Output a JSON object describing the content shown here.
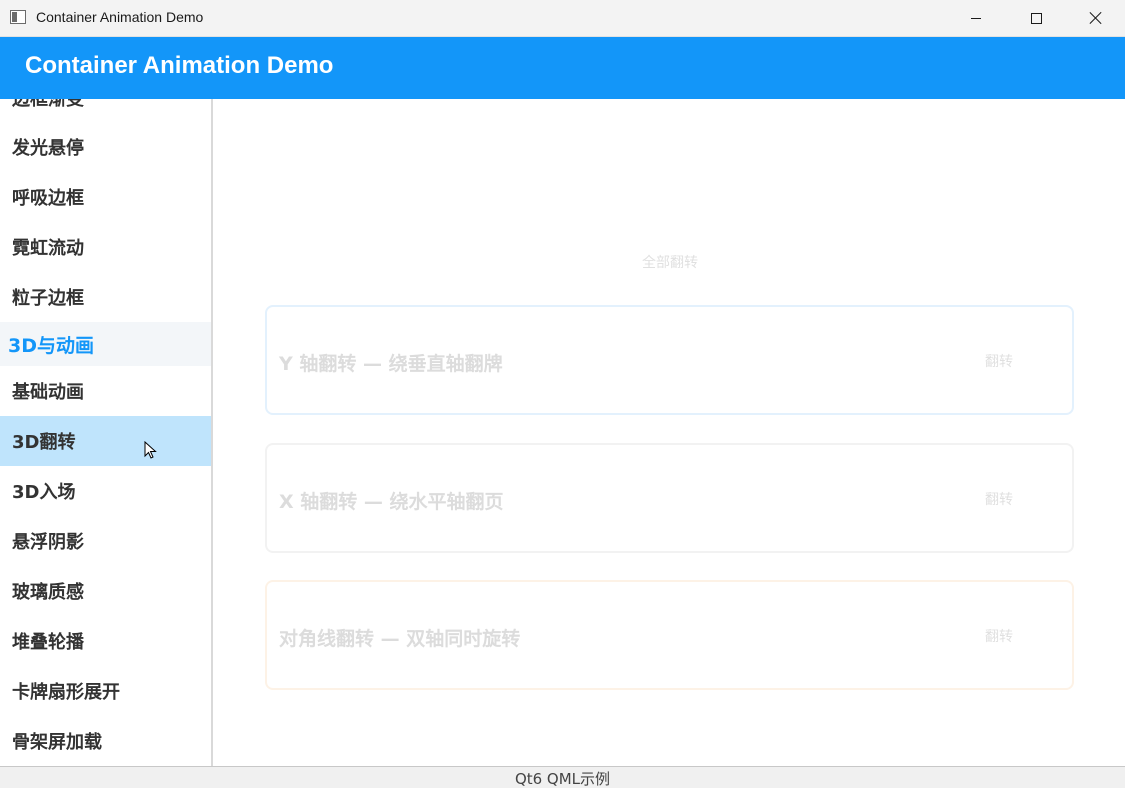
{
  "window": {
    "title": "Container Animation Demo"
  },
  "header": {
    "title": "Container Animation Demo"
  },
  "sidebar": {
    "items_top": [
      {
        "label": "边框渐变"
      },
      {
        "label": "发光悬停"
      },
      {
        "label": "呼吸边框"
      },
      {
        "label": "霓虹流动"
      },
      {
        "label": "粒子边框"
      }
    ],
    "category": {
      "label": "3D与动画"
    },
    "items_bottom": [
      {
        "label": "基础动画"
      },
      {
        "label": "3D翻转"
      },
      {
        "label": "3D入场"
      },
      {
        "label": "悬浮阴影"
      },
      {
        "label": "玻璃质感"
      },
      {
        "label": "堆叠轮播"
      },
      {
        "label": "卡牌扇形展开"
      },
      {
        "label": "骨架屏加载"
      }
    ],
    "selected": "3D翻转"
  },
  "content": {
    "flip_all_label": "全部翻转",
    "cards": [
      {
        "title": "Y 轴翻转 — 绕垂直轴翻牌",
        "button": "翻转",
        "border_color": "#e3f1fd"
      },
      {
        "title": "X 轴翻转 — 绕水平轴翻页",
        "button": "翻转",
        "border_color": "#f2f2f2"
      },
      {
        "title": "对角线翻转 — 双轴同时旋转",
        "button": "翻转",
        "border_color": "#fdf2e6"
      }
    ]
  },
  "status": {
    "text": "Qt6 QML示例"
  },
  "colors": {
    "accent": "#1396f9",
    "selected_bg": "#bfe4fc"
  }
}
